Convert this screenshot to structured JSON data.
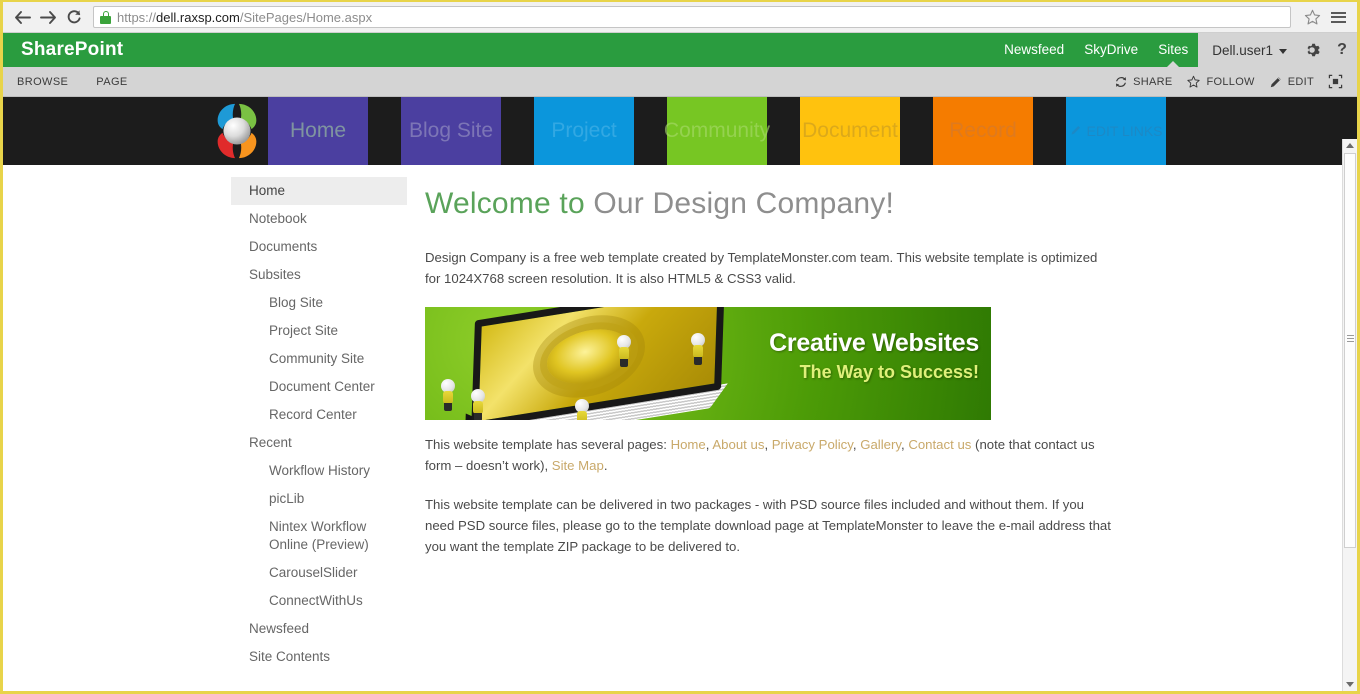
{
  "browser": {
    "back_icon": "arrow-left-icon",
    "forward_icon": "arrow-right-icon",
    "reload_icon": "reload-icon",
    "lock_icon": "lock-icon",
    "url_scheme": "https://",
    "url_host": "dell.raxsp.com",
    "url_path": "/SitePages/Home.aspx",
    "bookmark_icon": "star-icon",
    "menu_icon": "hamburger-menu-icon"
  },
  "suite": {
    "brand": "SharePoint",
    "links": [
      {
        "label": "Newsfeed",
        "active": false
      },
      {
        "label": "SkyDrive",
        "active": false
      },
      {
        "label": "Sites",
        "active": true
      }
    ],
    "user": "Dell.user1",
    "settings_icon": "gear-icon",
    "help_icon": "question-mark-icon"
  },
  "ribbon": {
    "tabs": [
      "BROWSE",
      "PAGE"
    ],
    "actions": [
      {
        "label": "SHARE",
        "icon": "share-icon"
      },
      {
        "label": "FOLLOW",
        "icon": "star-icon"
      },
      {
        "label": "EDIT",
        "icon": "pencil-icon"
      }
    ],
    "focus_icon": "focus-on-content-icon"
  },
  "topnav": {
    "logo_icon": "sharepoint-pinwheel-logo",
    "tiles": [
      {
        "label": "Home",
        "class": "t-home",
        "color": "#4b3fa0"
      },
      {
        "label": "Blog Site",
        "class": "t-blog",
        "color": "#4b3fa0"
      },
      {
        "label": "Project",
        "class": "t-project",
        "color": "#0b96dc"
      },
      {
        "label": "Community",
        "class": "t-comm",
        "color": "#77c623"
      },
      {
        "label": "Document",
        "class": "t-doc",
        "color": "#ffc20e"
      },
      {
        "label": "Record",
        "class": "t-rec",
        "color": "#f57c00"
      }
    ],
    "edit_links_label": "EDIT LINKS",
    "edit_links_icon": "pencil-icon"
  },
  "sidebar": {
    "items": [
      {
        "label": "Home",
        "level": 0,
        "selected": true
      },
      {
        "label": "Notebook",
        "level": 0,
        "selected": false
      },
      {
        "label": "Documents",
        "level": 0,
        "selected": false
      },
      {
        "label": "Subsites",
        "level": 0,
        "selected": false
      },
      {
        "label": "Blog Site",
        "level": 1,
        "selected": false
      },
      {
        "label": "Project Site",
        "level": 1,
        "selected": false
      },
      {
        "label": "Community Site",
        "level": 1,
        "selected": false
      },
      {
        "label": "Document Center",
        "level": 1,
        "selected": false
      },
      {
        "label": "Record Center",
        "level": 1,
        "selected": false
      },
      {
        "label": "Recent",
        "level": 0,
        "selected": false
      },
      {
        "label": "Workflow History",
        "level": 1,
        "selected": false
      },
      {
        "label": "picLib",
        "level": 1,
        "selected": false
      },
      {
        "label": "Nintex Workflow Online (Preview)",
        "level": 1,
        "selected": false,
        "wrap": true
      },
      {
        "label": "CarouselSlider",
        "level": 1,
        "selected": false
      },
      {
        "label": "ConnectWithUs",
        "level": 1,
        "selected": false
      },
      {
        "label": "Newsfeed",
        "level": 0,
        "selected": false
      },
      {
        "label": "Site Contents",
        "level": 0,
        "selected": false
      }
    ]
  },
  "main": {
    "title_green": "Welcome to",
    "title_gray": "Our Design Company!",
    "para1": "Design Company is a free web template created by TemplateMonster.com team. This website template is optimized for 1024X768 screen resolution. It is also HTML5 & CSS3 valid.",
    "banner": {
      "headline": "Creative Websites",
      "subline": "The Way to Success!"
    },
    "para2": {
      "lead": "This website template has several pages:",
      "links": [
        "Home",
        "About us",
        "Privacy Policy",
        "Gallery",
        "Contact us"
      ],
      "note": "(note that contact us form – doesn’t work),",
      "sitemap_link": "Site Map",
      "tail": "."
    },
    "para3": "This website template can be delivered in two packages - with PSD source files included and without them. If you need PSD source files, please go to the template download page at TemplateMonster to leave the e-mail address that you want the template ZIP package to be delivered to."
  },
  "colors": {
    "suite_green": "#2a9c3f",
    "title_green": "#5aa35a",
    "link_tan": "#c9a96a",
    "tile_strip_bg": "#1c1c1c"
  }
}
